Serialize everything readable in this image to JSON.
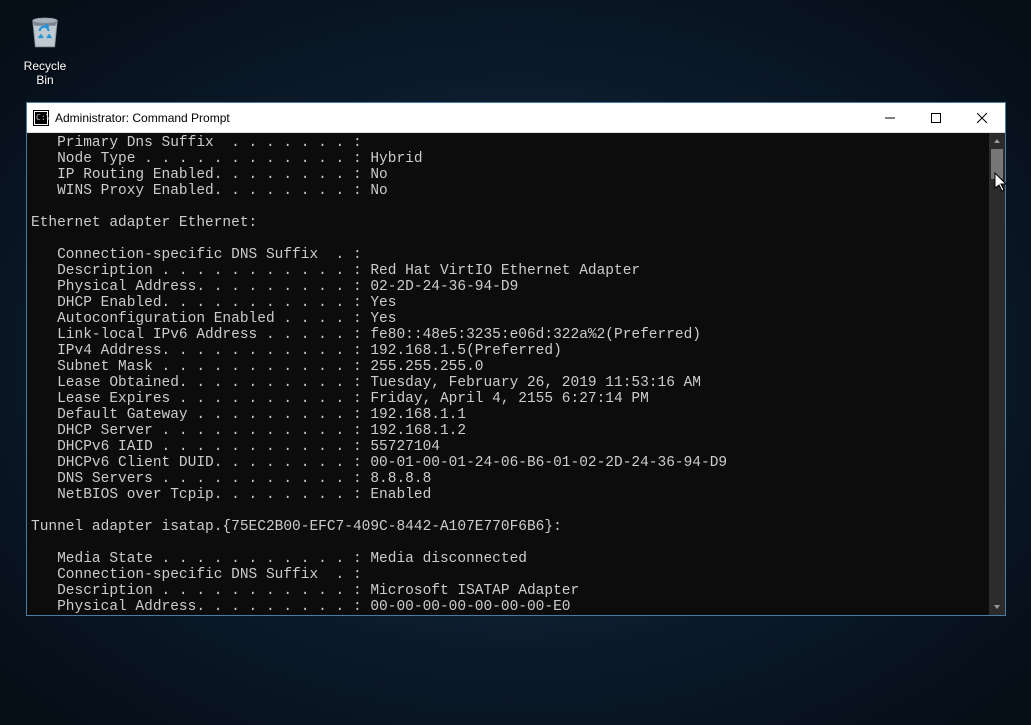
{
  "desktop": {
    "recycle_bin_label": "Recycle Bin"
  },
  "window": {
    "title": "Administrator: Command Prompt"
  },
  "terminal": {
    "lines": [
      "   Primary Dns Suffix  . . . . . . . :",
      "   Node Type . . . . . . . . . . . . : Hybrid",
      "   IP Routing Enabled. . . . . . . . : No",
      "   WINS Proxy Enabled. . . . . . . . : No",
      "",
      "Ethernet adapter Ethernet:",
      "",
      "   Connection-specific DNS Suffix  . :",
      "   Description . . . . . . . . . . . : Red Hat VirtIO Ethernet Adapter",
      "   Physical Address. . . . . . . . . : 02-2D-24-36-94-D9",
      "   DHCP Enabled. . . . . . . . . . . : Yes",
      "   Autoconfiguration Enabled . . . . : Yes",
      "   Link-local IPv6 Address . . . . . : fe80::48e5:3235:e06d:322a%2(Preferred)",
      "   IPv4 Address. . . . . . . . . . . : 192.168.1.5(Preferred)",
      "   Subnet Mask . . . . . . . . . . . : 255.255.255.0",
      "   Lease Obtained. . . . . . . . . . : Tuesday, February 26, 2019 11:53:16 AM",
      "   Lease Expires . . . . . . . . . . : Friday, April 4, 2155 6:27:14 PM",
      "   Default Gateway . . . . . . . . . : 192.168.1.1",
      "   DHCP Server . . . . . . . . . . . : 192.168.1.2",
      "   DHCPv6 IAID . . . . . . . . . . . : 55727104",
      "   DHCPv6 Client DUID. . . . . . . . : 00-01-00-01-24-06-B6-01-02-2D-24-36-94-D9",
      "   DNS Servers . . . . . . . . . . . : 8.8.8.8",
      "   NetBIOS over Tcpip. . . . . . . . : Enabled",
      "",
      "Tunnel adapter isatap.{75EC2B00-EFC7-409C-8442-A107E770F6B6}:",
      "",
      "   Media State . . . . . . . . . . . : Media disconnected",
      "   Connection-specific DNS Suffix  . :",
      "   Description . . . . . . . . . . . : Microsoft ISATAP Adapter",
      "   Physical Address. . . . . . . . . : 00-00-00-00-00-00-00-E0"
    ]
  }
}
